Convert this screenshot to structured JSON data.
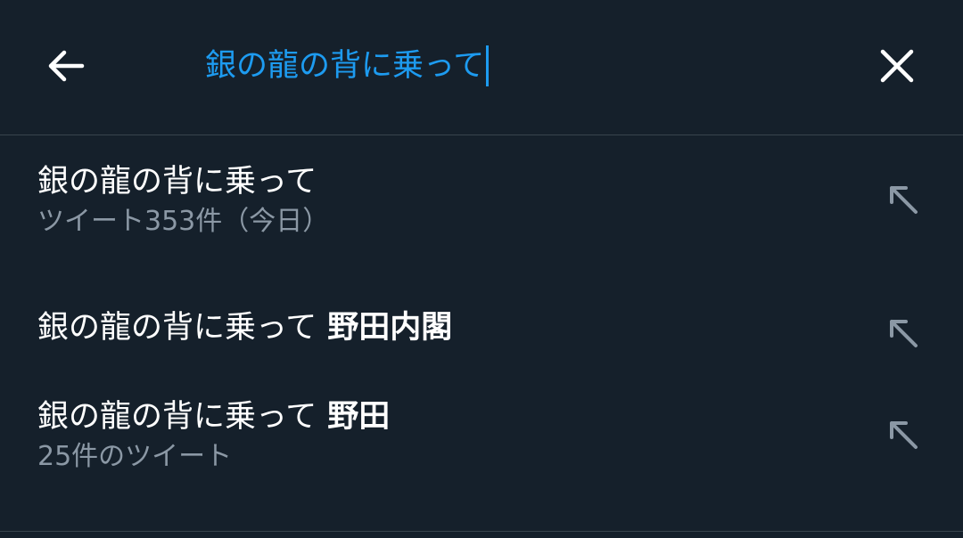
{
  "search": {
    "query": "銀の龍の背に乗って"
  },
  "suggestions": [
    {
      "text": "銀の龍の背に乗って",
      "bold": "",
      "subtitle": "ツイート353件（今日）"
    },
    {
      "text": "銀の龍の背に乗って",
      "bold": "野田内閣",
      "subtitle": ""
    },
    {
      "text": "銀の龍の背に乗って",
      "bold": "野田",
      "subtitle": "25件のツイート"
    }
  ],
  "colors": {
    "background": "#15202b",
    "accent": "#1d9bf0",
    "text_primary": "#ffffff",
    "text_secondary": "#8b98a5",
    "divider": "#38444d"
  },
  "icons": {
    "back": "arrow-left-icon",
    "clear": "close-icon",
    "fill": "arrow-up-left-icon"
  }
}
